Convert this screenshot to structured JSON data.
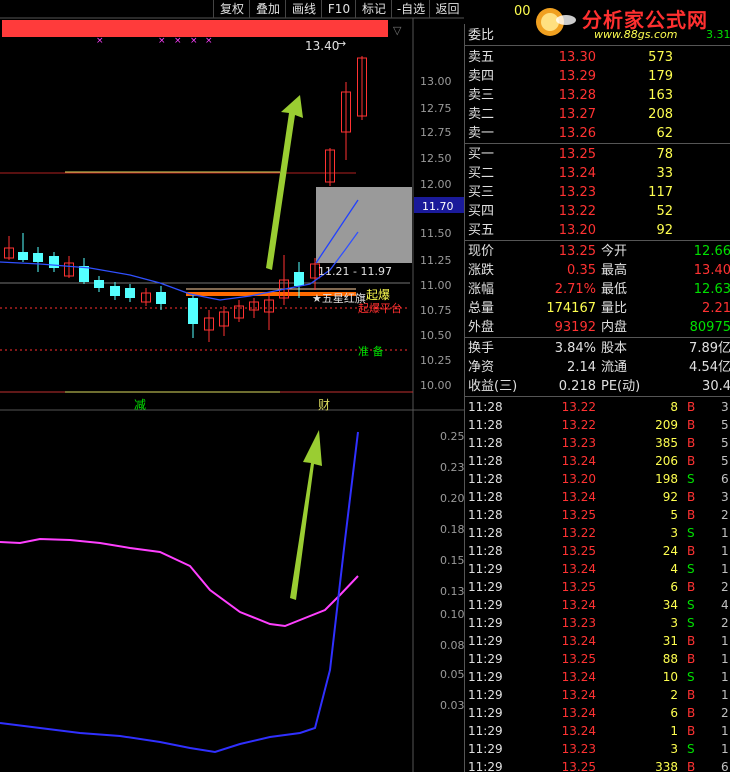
{
  "toolbar": {
    "buttons": [
      "复权",
      "叠加",
      "画线",
      "F10",
      "标记",
      "-自选",
      "返回"
    ]
  },
  "colors": {
    "up": "#ff3232",
    "down": "#54ffff",
    "ma": "#3050ff",
    "magenta": "#ff40ff",
    "arrow": "#9acd32",
    "yellow": "#ffff50",
    "green": "#00e000"
  },
  "main_chart": {
    "y_ticks": [
      "13.00",
      "12.75",
      "12.50",
      "12.25",
      "12.00",
      "11.75",
      "11.50",
      "11.25",
      "11.00",
      "10.75",
      "10.50",
      "10.25",
      "10.00"
    ],
    "high_label": "13.40",
    "current_price_tag": "11.70",
    "range_label": "11.21 - 11.97",
    "signal_qibao": "起爆",
    "signal_wuxing": "★五星红旗",
    "signal_platform": "起爆平台",
    "signal_zhunbei": "准 备",
    "marker_jian": "减",
    "marker_cai": "财"
  },
  "sub_chart": {
    "y_ticks": [
      "0.25",
      "0.23",
      "0.20",
      "0.18",
      "0.15",
      "0.13",
      "0.10",
      "0.08",
      "0.05",
      "0.03"
    ]
  },
  "logo": {
    "title": "分析家公式网",
    "url": "www.88gs.com",
    "code_fragment": "00",
    "side_fragment": "3.31"
  },
  "quote": {
    "weibi_label": "委比",
    "sell": [
      {
        "label": "卖五",
        "price": "13.30",
        "vol": "573"
      },
      {
        "label": "卖四",
        "price": "13.29",
        "vol": "179"
      },
      {
        "label": "卖三",
        "price": "13.28",
        "vol": "163"
      },
      {
        "label": "卖二",
        "price": "13.27",
        "vol": "208"
      },
      {
        "label": "卖一",
        "price": "13.26",
        "vol": "62"
      }
    ],
    "buy": [
      {
        "label": "买一",
        "price": "13.25",
        "vol": "78"
      },
      {
        "label": "买二",
        "price": "13.24",
        "vol": "33"
      },
      {
        "label": "买三",
        "price": "13.23",
        "vol": "117"
      },
      {
        "label": "买四",
        "price": "13.22",
        "vol": "52"
      },
      {
        "label": "买五",
        "price": "13.20",
        "vol": "92"
      }
    ],
    "stats1": [
      {
        "l1": "现价",
        "v1": "13.25",
        "l2": "今开",
        "v2": "12.66",
        "c1": "#ff3232",
        "c2": "#00e000"
      },
      {
        "l1": "涨跌",
        "v1": "0.35",
        "l2": "最高",
        "v2": "13.40",
        "c1": "#ff3232",
        "c2": "#ff3232"
      },
      {
        "l1": "涨幅",
        "v1": "2.71%",
        "l2": "最低",
        "v2": "12.63",
        "c1": "#ff3232",
        "c2": "#00e000"
      },
      {
        "l1": "总量",
        "v1": "174167",
        "l2": "量比",
        "v2": "2.21",
        "c1": "#ffff50",
        "c2": "#ff3232"
      },
      {
        "l1": "外盘",
        "v1": "93192",
        "l2": "内盘",
        "v2": "80975",
        "c1": "#ff3232",
        "c2": "#00e000"
      }
    ],
    "stats2": [
      {
        "l1": "换手",
        "v1": "3.84%",
        "l2": "股本",
        "v2": "7.89亿"
      },
      {
        "l1": "净资",
        "v1": "2.14",
        "l2": "流通",
        "v2": "4.54亿"
      },
      {
        "l1": "收益(三)",
        "v1": "0.218",
        "l2": "PE(动)",
        "v2": "30.4"
      }
    ],
    "ticks": [
      {
        "t": "11:28",
        "p": "13.22",
        "v": "8",
        "bs": "B",
        "n": "3"
      },
      {
        "t": "11:28",
        "p": "13.22",
        "v": "209",
        "bs": "B",
        "n": "5"
      },
      {
        "t": "11:28",
        "p": "13.23",
        "v": "385",
        "bs": "B",
        "n": "5"
      },
      {
        "t": "11:28",
        "p": "13.24",
        "v": "206",
        "bs": "B",
        "n": "5"
      },
      {
        "t": "11:28",
        "p": "13.20",
        "v": "198",
        "bs": "S",
        "n": "6"
      },
      {
        "t": "11:28",
        "p": "13.24",
        "v": "92",
        "bs": "B",
        "n": "3"
      },
      {
        "t": "11:28",
        "p": "13.25",
        "v": "5",
        "bs": "B",
        "n": "2"
      },
      {
        "t": "11:28",
        "p": "13.22",
        "v": "3",
        "bs": "S",
        "n": "1"
      },
      {
        "t": "11:28",
        "p": "13.25",
        "v": "24",
        "bs": "B",
        "n": "1"
      },
      {
        "t": "11:29",
        "p": "13.24",
        "v": "4",
        "bs": "S",
        "n": "1"
      },
      {
        "t": "11:29",
        "p": "13.25",
        "v": "6",
        "bs": "B",
        "n": "2"
      },
      {
        "t": "11:29",
        "p": "13.24",
        "v": "34",
        "bs": "S",
        "n": "4"
      },
      {
        "t": "11:29",
        "p": "13.23",
        "v": "3",
        "bs": "S",
        "n": "2"
      },
      {
        "t": "11:29",
        "p": "13.24",
        "v": "31",
        "bs": "B",
        "n": "1"
      },
      {
        "t": "11:29",
        "p": "13.25",
        "v": "88",
        "bs": "B",
        "n": "1"
      },
      {
        "t": "11:29",
        "p": "13.24",
        "v": "10",
        "bs": "S",
        "n": "1"
      },
      {
        "t": "11:29",
        "p": "13.24",
        "v": "2",
        "bs": "B",
        "n": "1"
      },
      {
        "t": "11:29",
        "p": "13.24",
        "v": "6",
        "bs": "B",
        "n": "2"
      },
      {
        "t": "11:29",
        "p": "13.24",
        "v": "1",
        "bs": "B",
        "n": "1"
      },
      {
        "t": "11:29",
        "p": "13.23",
        "v": "3",
        "bs": "S",
        "n": "1"
      },
      {
        "t": "11:29",
        "p": "13.25",
        "v": "338",
        "bs": "B",
        "n": "6"
      }
    ]
  }
}
